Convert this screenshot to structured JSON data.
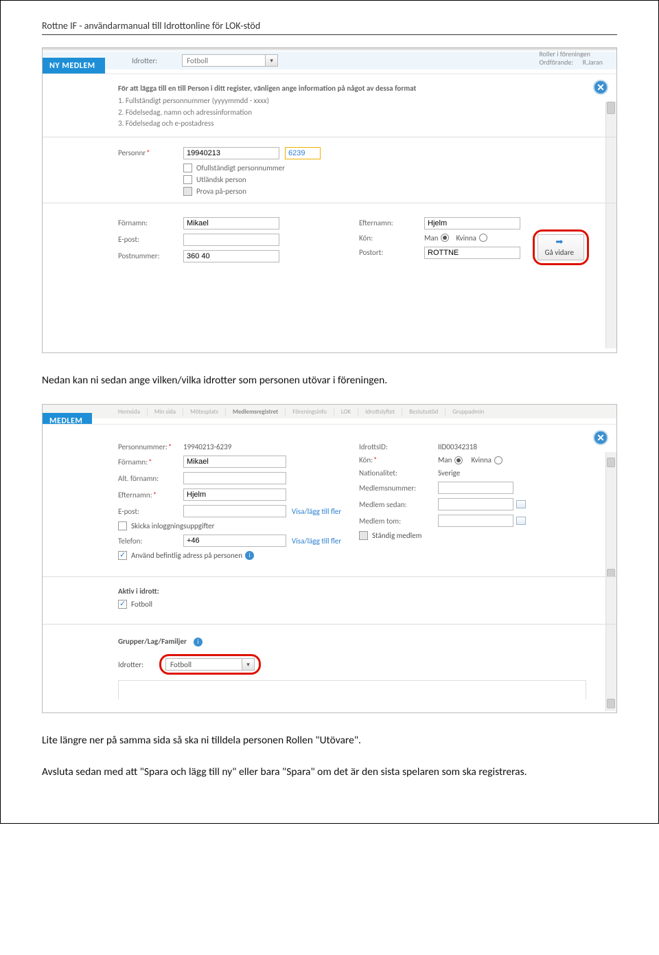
{
  "page_header": "Rottne IF -  användarmanual till Idrottonline för LOK-stöd",
  "shot1": {
    "bg_idrotter_lbl": "Idrotter:",
    "bg_idrotter_val": "Fotboll",
    "bg_roller": "Roller i föreningen",
    "bg_ordf": "Ordförande:",
    "bg_ordf_val": "R.Jaran",
    "tab": "NY MEDLEM",
    "intro_bold": "För att lägga till en till Person i ditt register, vänligen ange information på något av dessa format",
    "intro_1": "1. Fullständigt personnummer (yyyymmdd - xxxx)",
    "intro_2": "2. Födelsedag, namn och adressinformation",
    "intro_3": "3. Födelsedag och e-postadress",
    "personnr_lbl": "Personnr",
    "personnr_val1": "19940213",
    "personnr_val2": "6239",
    "chk1": "Ofullständigt personnummer",
    "chk2": "Utländsk person",
    "chk3": "Prova på-person",
    "fornamn_lbl": "Förnamn:",
    "fornamn_val": "Mikael",
    "efternamn_lbl": "Efternamn:",
    "efternamn_val": "Hjelm",
    "epost_lbl": "E-post:",
    "kon_lbl": "Kön:",
    "man": "Man",
    "kvinna": "Kvinna",
    "postnr_lbl": "Postnummer:",
    "postnr_val": "360 40",
    "postort_lbl": "Postort:",
    "postort_val": "ROTTNE",
    "go": "Gå vidare"
  },
  "narr1": "Nedan kan ni sedan ange vilken/vilka idrotter som personen utövar i föreningen.",
  "shot2": {
    "nav": [
      "Hemsida",
      "Min sida",
      "Mötesplats",
      "Medlemsregistret",
      "Föreningsinfo",
      "LOK",
      "Idrottslyftet",
      "Beslutsstöd",
      "Gruppadmin"
    ],
    "tab": "MEDLEM",
    "personnr_lbl": "Personnummer:",
    "personnr_val": "19940213-6239",
    "idrottsid_lbl": "IdrottsID:",
    "idrottsid_val": "IID00342318",
    "fornamn_lbl": "Förnamn:",
    "fornamn_val": "Mikael",
    "kon_lbl": "Kön:",
    "man": "Man",
    "kvinna": "Kvinna",
    "alt_fornamn_lbl": "Alt. förnamn:",
    "nationalitet_lbl": "Nationalitet:",
    "nationalitet_val": "Sverige",
    "efternamn_lbl": "Efternamn:",
    "efternamn_val": "Hjelm",
    "medlemsnr_lbl": "Medlemsnummer:",
    "epost_lbl": "E-post:",
    "visa_link": "Visa/lägg till fler",
    "medlem_sedan_lbl": "Medlem sedan:",
    "skicka_lbl": "Skicka inloggningsuppgifter",
    "medlem_tom_lbl": "Medlem tom:",
    "telefon_lbl": "Telefon:",
    "telefon_val": "+46",
    "standig_lbl": "Ständig medlem",
    "anvand_lbl": "Använd befintlig adress på personen",
    "aktiv_title": "Aktiv i idrott:",
    "fotboll": "Fotboll",
    "grupper_title": "Grupper/Lag/Familjer",
    "idrotter_lbl": "Idrotter:",
    "idrotter_val": "Fotboll"
  },
  "narr2": "Lite längre ner på samma sida så ska ni tilldela personen Rollen \"Utövare\".",
  "narr3": "Avsluta sedan med att \"Spara och lägg till ny\" eller bara \"Spara\" om det är den sista spelaren som ska registreras."
}
